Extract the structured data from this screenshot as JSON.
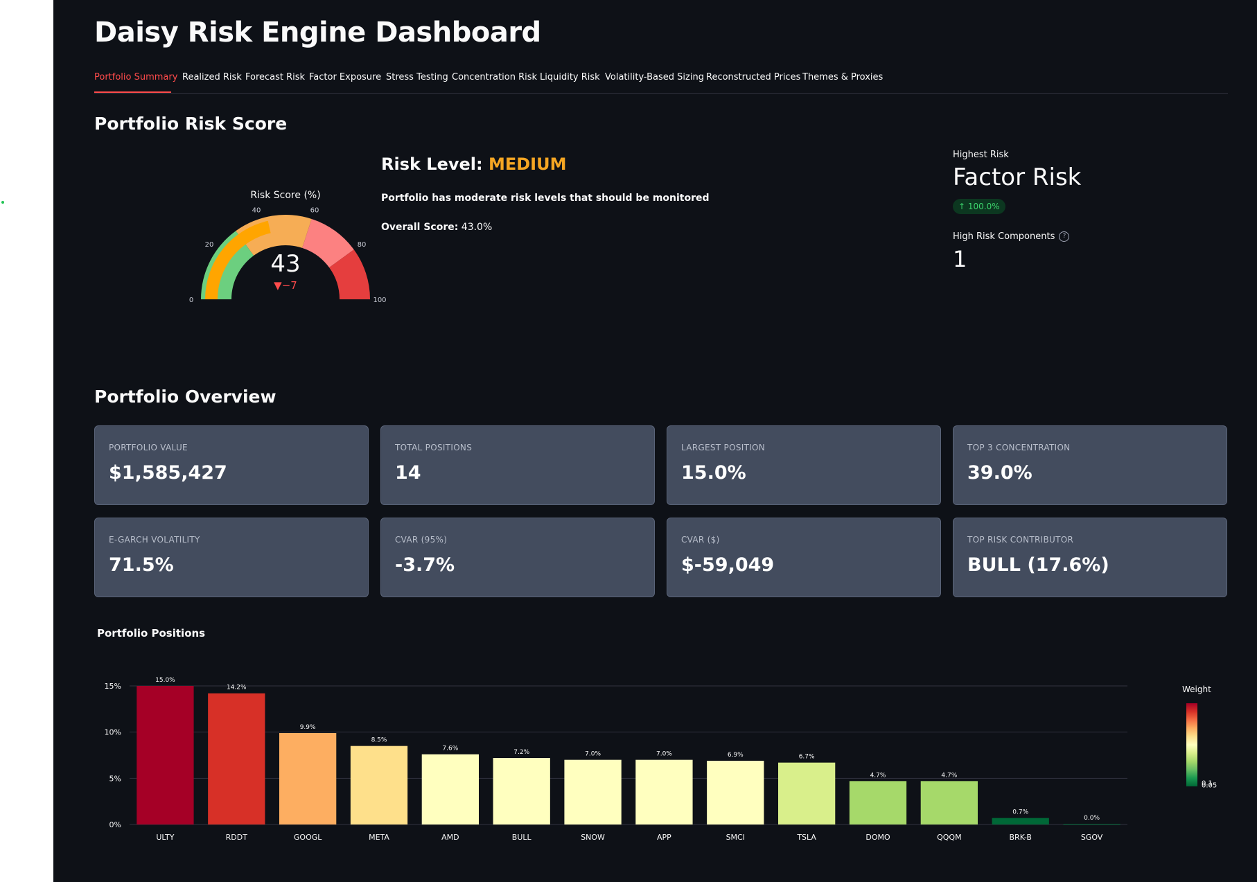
{
  "app": {
    "title": "Daisy Risk Engine Dashboard"
  },
  "tabs": [
    {
      "label": "Portfolio Summary",
      "active": true
    },
    {
      "label": "Realized Risk"
    },
    {
      "label": "Forecast Risk"
    },
    {
      "label": "Factor Exposure"
    },
    {
      "label": "Stress Testing"
    },
    {
      "label": "Concentration Risk"
    },
    {
      "label": "Liquidity Risk"
    },
    {
      "label": "Volatility-Based Sizing"
    },
    {
      "label": "Reconstructed Prices"
    },
    {
      "label": "Themes & Proxies"
    }
  ],
  "risk_score": {
    "heading": "Portfolio Risk Score",
    "gauge": {
      "title": "Risk Score (%)",
      "value": 43,
      "delta": "▼−7",
      "min": 0,
      "max": 100,
      "ticks": [
        "0",
        "20",
        "40",
        "60",
        "80",
        "100"
      ],
      "steps": [
        {
          "from": 0,
          "to": 30,
          "color": "#6ccf7f"
        },
        {
          "from": 30,
          "to": 60,
          "color": "#f6ad55"
        },
        {
          "from": 60,
          "to": 80,
          "color": "#fc8181"
        },
        {
          "from": 80,
          "to": 100,
          "color": "#e53e3e"
        }
      ],
      "bar_color": "#ffa500",
      "delta_color": "#ff4b4b"
    },
    "level_prefix": "Risk Level: ",
    "level": "MEDIUM",
    "level_color": "#f5a623",
    "description": "Portfolio has moderate risk levels that should be monitored",
    "overall_label": "Overall Score:",
    "overall_value": " 43.0%"
  },
  "highest_risk": {
    "label": "Highest Risk",
    "value": "Factor Risk",
    "delta": "100.0%",
    "delta_icon": "arrow-up-icon",
    "components_label": "High Risk Components",
    "components_help_icon": "help-circle-icon",
    "components_value": "1"
  },
  "overview": {
    "heading": "Portfolio Overview",
    "cards": [
      {
        "label": "PORTFOLIO VALUE",
        "value": "$1,585,427"
      },
      {
        "label": "TOTAL POSITIONS",
        "value": "14"
      },
      {
        "label": "LARGEST POSITION",
        "value": "15.0%"
      },
      {
        "label": "TOP 3 CONCENTRATION",
        "value": "39.0%"
      },
      {
        "label": "E-GARCH VOLATILITY",
        "value": "71.5%"
      },
      {
        "label": "CVAR (95%)",
        "value": "-3.7%"
      },
      {
        "label": "CVAR ($)",
        "value": "$-59,049"
      },
      {
        "label": "TOP RISK CONTRIBUTOR",
        "value": "BULL (17.6%)"
      }
    ]
  },
  "chart_data": {
    "type": "bar",
    "title": "Portfolio Positions",
    "categories": [
      "ULTY",
      "RDDT",
      "GOOGL",
      "META",
      "AMD",
      "BULL",
      "SNOW",
      "APP",
      "SMCI",
      "TSLA",
      "DOMO",
      "QQQM",
      "BRK-B",
      "SGOV"
    ],
    "values": [
      15.0,
      14.2,
      9.9,
      8.5,
      7.6,
      7.2,
      7.0,
      7.0,
      6.9,
      6.7,
      4.7,
      4.7,
      0.7,
      0.0
    ],
    "data_labels": [
      "15.0%",
      "14.2%",
      "9.9%",
      "8.5%",
      "7.6%",
      "7.2%",
      "7.0%",
      "7.0%",
      "6.9%",
      "6.7%",
      "4.7%",
      "4.7%",
      "0.7%",
      "0.0%"
    ],
    "ylim": [
      0,
      15
    ],
    "ytick_values": [
      0,
      5,
      10,
      15
    ],
    "ytick_labels": [
      "0%",
      "5%",
      "10%",
      "15%"
    ],
    "grid": true,
    "colorbar": {
      "title": "Weight",
      "tick_labels": [
        "0.1",
        "0.05"
      ],
      "tick_values": [
        0.1,
        0.05
      ],
      "colors": [
        "#a50026",
        "#d73027",
        "#f46d43",
        "#fdae61",
        "#fee08b",
        "#ffffbf",
        "#d9ef8b",
        "#a6d96a",
        "#66bd63",
        "#1a9850",
        "#006837"
      ]
    },
    "colorscale": "RdYlGn reversed, by weight",
    "legend_position": "right"
  }
}
